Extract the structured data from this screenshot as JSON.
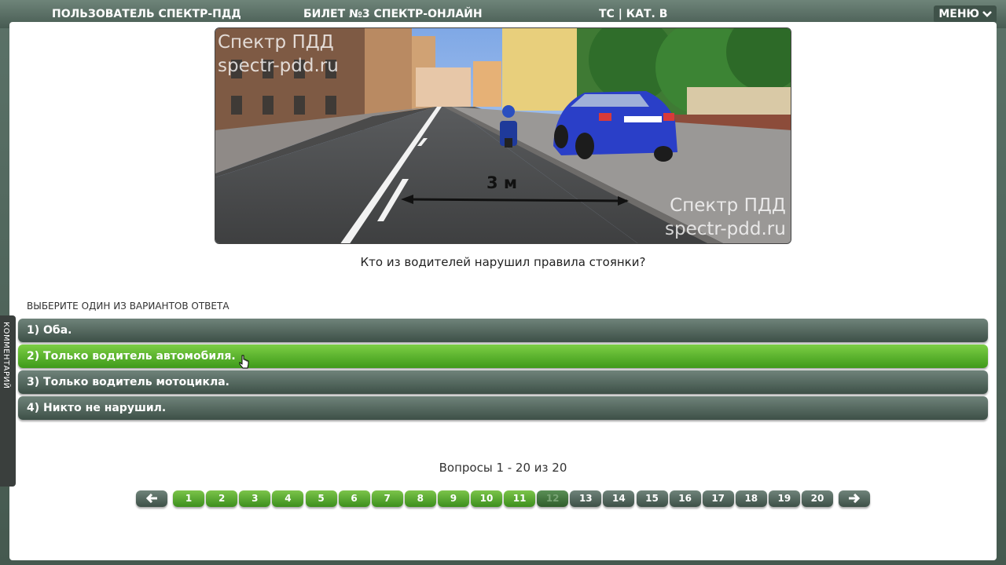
{
  "header": {
    "user": "ПОЛЬЗОВАТЕЛЬ СПЕКТР-ПДД",
    "ticket": "БИЛЕТ №3 СПЕКТР-ОНЛАЙН",
    "category": "ТС | КАТ. В",
    "menu_label": "МЕНЮ",
    "menu_icon": "chevron-down-icon"
  },
  "image": {
    "watermark_line1": "Спектр ПДД",
    "watermark_line2": "spectr-pdd.ru",
    "distance_label": "3 м"
  },
  "question": {
    "text": "Кто из водителей нарушил правила стоянки?"
  },
  "answers": {
    "prompt": "ВЫБЕРИТЕ ОДИН ИЗ ВАРИАНТОВ ОТВЕТА",
    "options": [
      "1) Оба.",
      "2) Только водитель автомобиля.",
      "3) Только водитель мотоцикла.",
      "4) Никто не нарушил."
    ],
    "selected_index": 1,
    "selected_color": "#5cb82e"
  },
  "side_tab": {
    "label": "КОММЕНТАРИЙ"
  },
  "pagination": {
    "counter": "Вопросы 1 - 20 из 20",
    "prev_icon": "arrow-left-icon",
    "next_icon": "arrow-right-icon",
    "pages": [
      "1",
      "2",
      "3",
      "4",
      "5",
      "6",
      "7",
      "8",
      "9",
      "10",
      "11",
      "12",
      "13",
      "14",
      "15",
      "16",
      "17",
      "18",
      "19",
      "20"
    ],
    "current": "12",
    "answered_through": 11,
    "answered_color": "#5aa832"
  }
}
